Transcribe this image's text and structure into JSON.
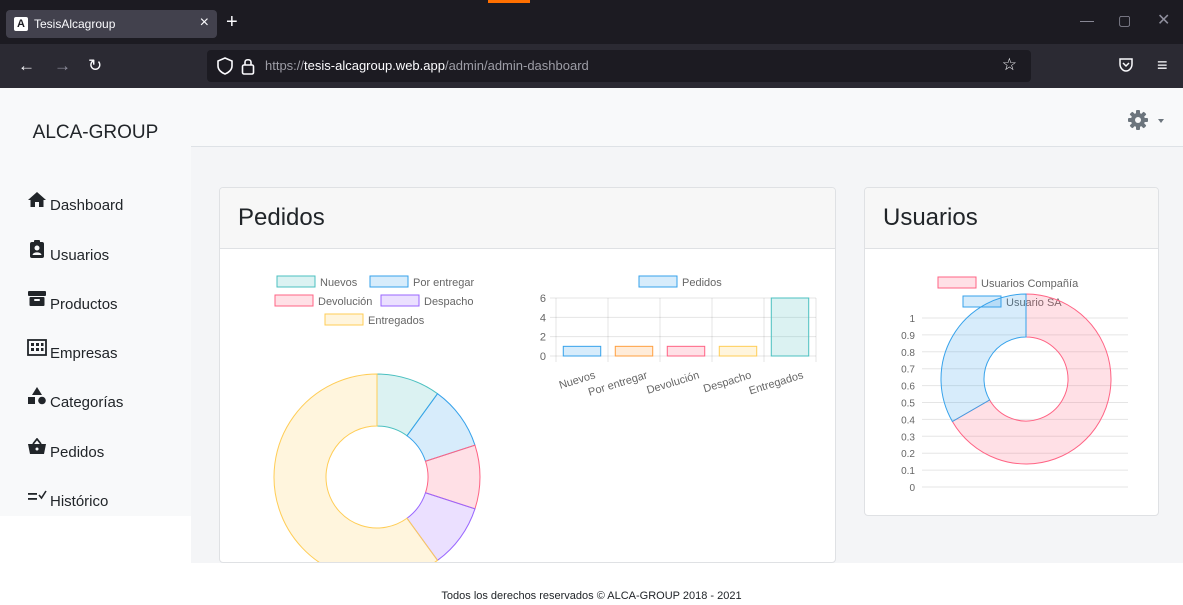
{
  "browser": {
    "tab_title": "TesisAlcagroup",
    "favicon_letter": "A",
    "url_prefix": "https://",
    "url_host": "tesis-alcagroup.web.app",
    "url_path": "/admin/admin-dashboard"
  },
  "sidebar": {
    "brand": "ALCA-GROUP",
    "items": [
      {
        "label": "Dashboard",
        "icon": "home-icon"
      },
      {
        "label": "Usuarios",
        "icon": "id-badge-icon"
      },
      {
        "label": "Productos",
        "icon": "archive-icon"
      },
      {
        "label": "Empresas",
        "icon": "building-icon"
      },
      {
        "label": "Categorías",
        "icon": "shapes-icon"
      },
      {
        "label": "Pedidos",
        "icon": "basket-icon"
      },
      {
        "label": "Histórico",
        "icon": "list-check-icon"
      }
    ]
  },
  "cards": {
    "pedidos_title": "Pedidos",
    "usuarios_title": "Usuarios"
  },
  "footer": "Todos los derechos reservados © ALCA-GROUP 2018 - 2021",
  "chart_data": [
    {
      "type": "pie",
      "variant": "doughnut",
      "categories": [
        "Nuevos",
        "Por entregar",
        "Devolución",
        "Despacho",
        "Entregados"
      ],
      "values": [
        1,
        1,
        1,
        1,
        6
      ],
      "colors": [
        "#4bc0c0",
        "#36a2eb",
        "#ff6384",
        "#9966ff",
        "#ffcd56"
      ],
      "legend": "top"
    },
    {
      "type": "bar",
      "categories": [
        "Nuevos",
        "Por entregar",
        "Devolución",
        "Despacho",
        "Entregados"
      ],
      "series": [
        {
          "name": "Pedidos",
          "values": [
            1,
            1,
            1,
            1,
            6
          ]
        }
      ],
      "bar_colors": [
        "#36a2eb",
        "#ff9f40",
        "#ff6384",
        "#ffcd56",
        "#4bc0c0"
      ],
      "ylim": [
        0,
        6
      ],
      "yticks": [
        0,
        2,
        4,
        6
      ],
      "grid": true,
      "legend": "top"
    },
    {
      "type": "pie",
      "variant": "doughnut",
      "categories": [
        "Usuarios Compañía",
        "Usuario SA"
      ],
      "values": [
        2,
        1
      ],
      "colors": [
        "#ff6384",
        "#36a2eb"
      ],
      "yticks": [
        "1",
        "0.9",
        "0.8",
        "0.7",
        "0.6",
        "0.5",
        "0.4",
        "0.3",
        "0.2",
        "0.1",
        "0"
      ],
      "grid": true,
      "legend": "top"
    }
  ]
}
